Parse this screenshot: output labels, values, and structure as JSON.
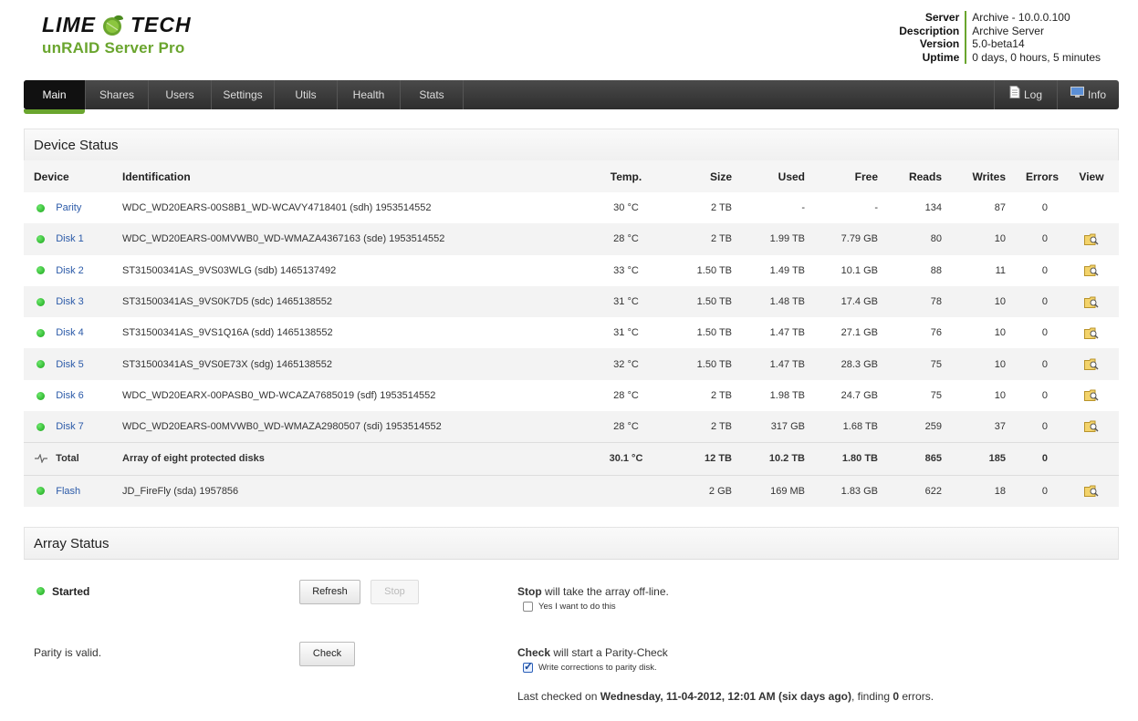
{
  "header": {
    "brand_left": "LIME",
    "brand_right": "TECH",
    "product": "unRAID Server Pro",
    "accent": "#6aa52e",
    "server_info": [
      {
        "key": "Server",
        "value": "Archive - 10.0.0.100"
      },
      {
        "key": "Description",
        "value": "Archive Server"
      },
      {
        "key": "Version",
        "value": "5.0-beta14"
      },
      {
        "key": "Uptime",
        "value": "0 days, 0 hours, 5 minutes"
      }
    ]
  },
  "nav": {
    "tabs": [
      "Main",
      "Shares",
      "Users",
      "Settings",
      "Utils",
      "Health",
      "Stats"
    ],
    "active": "Main",
    "right": [
      {
        "label": "Log",
        "icon": "document-icon"
      },
      {
        "label": "Info",
        "icon": "monitor-icon"
      }
    ]
  },
  "device_status": {
    "title": "Device Status",
    "columns": [
      "Device",
      "Identification",
      "Temp.",
      "Size",
      "Used",
      "Free",
      "Reads",
      "Writes",
      "Errors",
      "View"
    ],
    "rows": [
      {
        "device": "Parity",
        "id": "WDC_WD20EARS-00S8B1_WD-WCAVY4718401 (sdh) 1953514552",
        "temp": "30 °C",
        "size": "2 TB",
        "used": "-",
        "free": "-",
        "reads": "134",
        "writes": "87",
        "errors": "0",
        "view": false
      },
      {
        "device": "Disk 1",
        "id": "WDC_WD20EARS-00MVWB0_WD-WMAZA4367163 (sde) 1953514552",
        "temp": "28 °C",
        "size": "2 TB",
        "used": "1.99 TB",
        "free": "7.79 GB",
        "reads": "80",
        "writes": "10",
        "errors": "0",
        "view": true
      },
      {
        "device": "Disk 2",
        "id": "ST31500341AS_9VS03WLG (sdb) 1465137492",
        "temp": "33 °C",
        "size": "1.50 TB",
        "used": "1.49 TB",
        "free": "10.1 GB",
        "reads": "88",
        "writes": "11",
        "errors": "0",
        "view": true
      },
      {
        "device": "Disk 3",
        "id": "ST31500341AS_9VS0K7D5 (sdc) 1465138552",
        "temp": "31 °C",
        "size": "1.50 TB",
        "used": "1.48 TB",
        "free": "17.4 GB",
        "reads": "78",
        "writes": "10",
        "errors": "0",
        "view": true
      },
      {
        "device": "Disk 4",
        "id": "ST31500341AS_9VS1Q16A (sdd) 1465138552",
        "temp": "31 °C",
        "size": "1.50 TB",
        "used": "1.47 TB",
        "free": "27.1 GB",
        "reads": "76",
        "writes": "10",
        "errors": "0",
        "view": true
      },
      {
        "device": "Disk 5",
        "id": "ST31500341AS_9VS0E73X (sdg) 1465138552",
        "temp": "32 °C",
        "size": "1.50 TB",
        "used": "1.47 TB",
        "free": "28.3 GB",
        "reads": "75",
        "writes": "10",
        "errors": "0",
        "view": true
      },
      {
        "device": "Disk 6",
        "id": "WDC_WD20EARX-00PASB0_WD-WCAZA7685019 (sdf) 1953514552",
        "temp": "28 °C",
        "size": "2 TB",
        "used": "1.98 TB",
        "free": "24.7 GB",
        "reads": "75",
        "writes": "10",
        "errors": "0",
        "view": true
      },
      {
        "device": "Disk 7",
        "id": "WDC_WD20EARS-00MVWB0_WD-WMAZA2980507 (sdi) 1953514552",
        "temp": "28 °C",
        "size": "2 TB",
        "used": "317 GB",
        "free": "1.68 TB",
        "reads": "259",
        "writes": "37",
        "errors": "0",
        "view": true
      }
    ],
    "total": {
      "device": "Total",
      "id": "Array of eight protected disks",
      "temp": "30.1 °C",
      "size": "12 TB",
      "used": "10.2 TB",
      "free": "1.80 TB",
      "reads": "865",
      "writes": "185",
      "errors": "0"
    },
    "flash": {
      "device": "Flash",
      "id": "JD_FireFly (sda) 1957856",
      "temp": "",
      "size": "2 GB",
      "used": "169 MB",
      "free": "1.83 GB",
      "reads": "622",
      "writes": "18",
      "errors": "0",
      "view": true
    }
  },
  "array_status": {
    "title": "Array Status",
    "state": "Started",
    "refresh_label": "Refresh",
    "stop_label": "Stop",
    "stop_word": "Stop",
    "stop_desc": " will take the array off-line.",
    "stop_confirm": "Yes I want to do this",
    "stop_confirm_checked": false,
    "parity_text": "Parity is valid.",
    "check_label": "Check",
    "check_word": "Check",
    "check_desc": " will start a Parity-Check",
    "write_corrections": "Write corrections to parity disk.",
    "write_corrections_checked": true,
    "last_checked_prefix": "Last checked on ",
    "last_checked_date": "Wednesday, 11-04-2012, 12:01 AM (six days ago)",
    "last_checked_mid": ", finding ",
    "last_checked_errors": "0",
    "last_checked_suffix": " errors."
  }
}
